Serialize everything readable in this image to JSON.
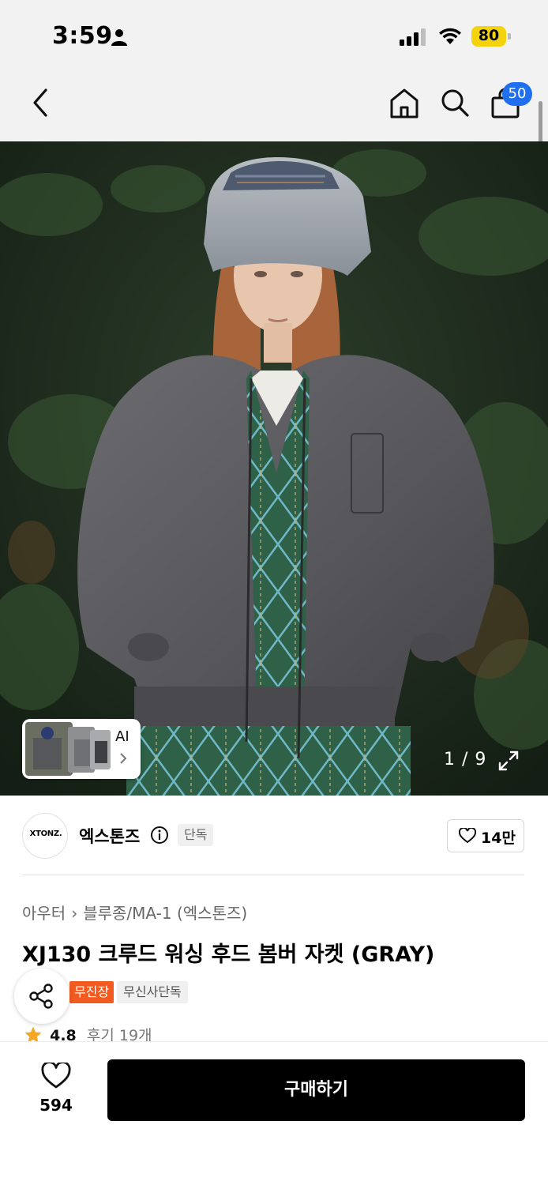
{
  "status_bar": {
    "time": "3:59",
    "battery": "80"
  },
  "nav": {
    "cart_count": "50"
  },
  "gallery": {
    "ai_label": "AI",
    "page_counter": "1 / 9"
  },
  "brand": {
    "logo_text": "XTONZ.",
    "name": "엑스톤즈",
    "exclusive_tag": "단독",
    "like_count": "14만"
  },
  "product": {
    "breadcrumb": [
      "아우터",
      "블루종/MA-1 (엑스톤즈)"
    ],
    "title": "XJ130 크루드 워싱 후드 봄버 자켓 (GRAY)",
    "tags": [
      "무진장",
      "무신사단독"
    ],
    "rating": "4.8",
    "review_text": "후기 19개"
  },
  "bottom_bar": {
    "like_count": "594",
    "buy_label": "구매하기"
  },
  "colors": {
    "cart_badge": "#1f6fef",
    "battery": "#f5d20e",
    "tag_orange": "#f25a1f",
    "star": "#f5a623",
    "buy_button": "#000000"
  },
  "icons": [
    "person-icon",
    "signal-icon",
    "wifi-icon",
    "back-icon",
    "home-icon",
    "search-icon",
    "shopping-bag-icon",
    "expand-icon",
    "info-icon",
    "heart-icon",
    "share-icon",
    "star-icon",
    "chevron-right-icon"
  ]
}
